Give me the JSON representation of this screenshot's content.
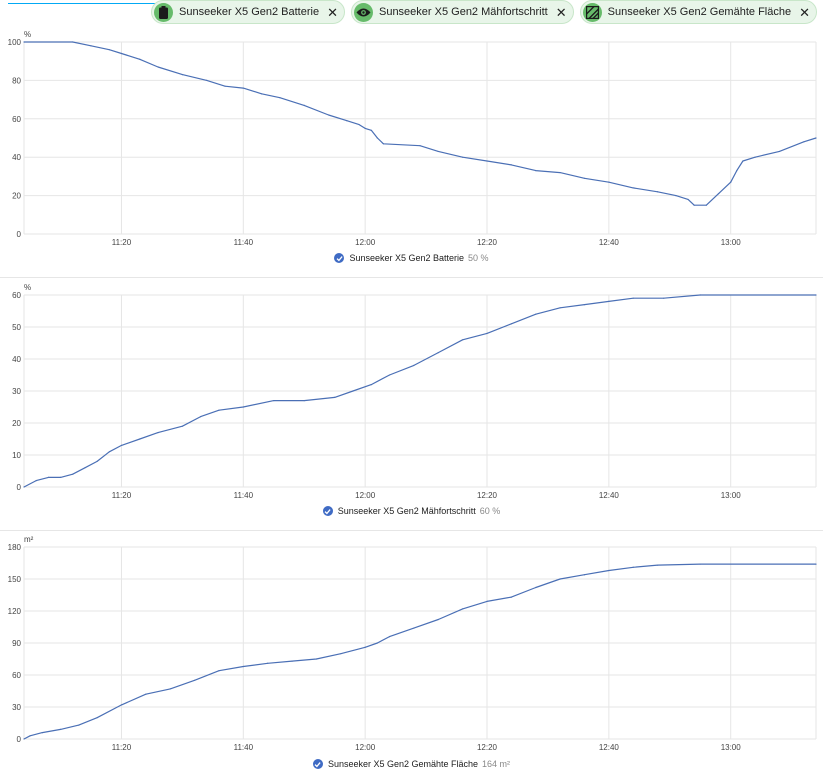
{
  "header": {
    "chips": [
      {
        "label": "Sunseeker X5 Gen2 Batterie",
        "icon": "battery-icon"
      },
      {
        "label": "Sunseeker X5 Gen2 Mähfortschritt",
        "icon": "eye-icon"
      },
      {
        "label": "Sunseeker X5 Gen2 Gemähte Fläche",
        "icon": "texture-icon"
      }
    ],
    "remove_glyph": "✕"
  },
  "colors": {
    "line": "#4a6fb5",
    "grid": "#e6e6e6",
    "accent": "#03a9f4",
    "chip_bg": "#e8f5e9",
    "chip_icon": "#66bb6a"
  },
  "legends": [
    {
      "label": "Sunseeker X5 Gen2 Batterie",
      "value": "50 %"
    },
    {
      "label": "Sunseeker X5 Gen2 Mähfortschritt",
      "value": "60 %"
    },
    {
      "label": "Sunseeker X5 Gen2 Gemähte Fläche",
      "value": "164 m²"
    }
  ],
  "chart_data": [
    {
      "type": "line",
      "unit": "%",
      "ylim": [
        0,
        100
      ],
      "yticks": [
        0,
        20,
        40,
        60,
        80,
        100
      ],
      "xlim": [
        "11:04",
        "13:14"
      ],
      "xticks": [
        "11:20",
        "11:40",
        "12:00",
        "12:20",
        "12:40",
        "13:00"
      ],
      "grid": true,
      "series": [
        {
          "name": "Sunseeker X5 Gen2 Batterie",
          "points": [
            [
              "11:04",
              100
            ],
            [
              "11:12",
              100
            ],
            [
              "11:15",
              98
            ],
            [
              "11:18",
              96
            ],
            [
              "11:20",
              94
            ],
            [
              "11:23",
              91
            ],
            [
              "11:26",
              87
            ],
            [
              "11:30",
              83
            ],
            [
              "11:34",
              80
            ],
            [
              "11:37",
              77
            ],
            [
              "11:40",
              76
            ],
            [
              "11:43",
              73
            ],
            [
              "11:46",
              71
            ],
            [
              "11:50",
              67
            ],
            [
              "11:54",
              62
            ],
            [
              "11:57",
              59
            ],
            [
              "11:59",
              57
            ],
            [
              "12:00",
              55
            ],
            [
              "12:01",
              54
            ],
            [
              "12:02",
              50
            ],
            [
              "12:03",
              47
            ],
            [
              "12:09",
              46
            ],
            [
              "12:12",
              43
            ],
            [
              "12:16",
              40
            ],
            [
              "12:20",
              38
            ],
            [
              "12:24",
              36
            ],
            [
              "12:28",
              33
            ],
            [
              "12:32",
              32
            ],
            [
              "12:36",
              29
            ],
            [
              "12:40",
              27
            ],
            [
              "12:44",
              24
            ],
            [
              "12:48",
              22
            ],
            [
              "12:51",
              20
            ],
            [
              "12:53",
              18
            ],
            [
              "12:54",
              15
            ],
            [
              "12:56",
              15
            ],
            [
              "12:58",
              21
            ],
            [
              "13:00",
              27
            ],
            [
              "13:01",
              33
            ],
            [
              "13:02",
              38
            ],
            [
              "13:04",
              40
            ],
            [
              "13:08",
              43
            ],
            [
              "13:12",
              48
            ],
            [
              "13:14",
              50
            ]
          ]
        }
      ]
    },
    {
      "type": "line",
      "unit": "%",
      "ylim": [
        0,
        60
      ],
      "yticks": [
        0,
        10,
        20,
        30,
        40,
        50,
        60
      ],
      "xlim": [
        "11:04",
        "13:14"
      ],
      "xticks": [
        "11:20",
        "11:40",
        "12:00",
        "12:20",
        "12:40",
        "13:00"
      ],
      "grid": true,
      "series": [
        {
          "name": "Sunseeker X5 Gen2 Mähfortschritt",
          "points": [
            [
              "11:04",
              0
            ],
            [
              "11:06",
              2
            ],
            [
              "11:08",
              3
            ],
            [
              "11:10",
              3
            ],
            [
              "11:12",
              4
            ],
            [
              "11:14",
              6
            ],
            [
              "11:16",
              8
            ],
            [
              "11:18",
              11
            ],
            [
              "11:20",
              13
            ],
            [
              "11:23",
              15
            ],
            [
              "11:26",
              17
            ],
            [
              "11:30",
              19
            ],
            [
              "11:33",
              22
            ],
            [
              "11:36",
              24
            ],
            [
              "11:40",
              25
            ],
            [
              "11:45",
              27
            ],
            [
              "11:50",
              27
            ],
            [
              "11:55",
              28
            ],
            [
              "11:58",
              30
            ],
            [
              "12:01",
              32
            ],
            [
              "12:04",
              35
            ],
            [
              "12:08",
              38
            ],
            [
              "12:12",
              42
            ],
            [
              "12:16",
              46
            ],
            [
              "12:20",
              48
            ],
            [
              "12:24",
              51
            ],
            [
              "12:28",
              54
            ],
            [
              "12:32",
              56
            ],
            [
              "12:36",
              57
            ],
            [
              "12:40",
              58
            ],
            [
              "12:44",
              59
            ],
            [
              "12:49",
              59
            ],
            [
              "12:55",
              60
            ],
            [
              "13:14",
              60
            ]
          ]
        }
      ]
    },
    {
      "type": "line",
      "unit": "m²",
      "ylim": [
        0,
        180
      ],
      "yticks": [
        0,
        30,
        60,
        90,
        120,
        150,
        180
      ],
      "xlim": [
        "11:04",
        "13:14"
      ],
      "xticks": [
        "11:20",
        "11:40",
        "12:00",
        "12:20",
        "12:40",
        "13:00"
      ],
      "grid": true,
      "series": [
        {
          "name": "Sunseeker X5 Gen2 Gemähte Fläche",
          "points": [
            [
              "11:04",
              0
            ],
            [
              "11:05",
              3
            ],
            [
              "11:07",
              6
            ],
            [
              "11:10",
              9
            ],
            [
              "11:13",
              13
            ],
            [
              "11:16",
              20
            ],
            [
              "11:20",
              32
            ],
            [
              "11:24",
              42
            ],
            [
              "11:28",
              47
            ],
            [
              "11:32",
              55
            ],
            [
              "11:36",
              64
            ],
            [
              "11:40",
              68
            ],
            [
              "11:44",
              71
            ],
            [
              "11:48",
              73
            ],
            [
              "11:52",
              75
            ],
            [
              "11:56",
              80
            ],
            [
              "12:00",
              86
            ],
            [
              "12:02",
              90
            ],
            [
              "12:04",
              96
            ],
            [
              "12:08",
              104
            ],
            [
              "12:12",
              112
            ],
            [
              "12:16",
              122
            ],
            [
              "12:20",
              129
            ],
            [
              "12:24",
              133
            ],
            [
              "12:28",
              142
            ],
            [
              "12:32",
              150
            ],
            [
              "12:36",
              154
            ],
            [
              "12:40",
              158
            ],
            [
              "12:44",
              161
            ],
            [
              "12:48",
              163
            ],
            [
              "12:55",
              164
            ],
            [
              "13:14",
              164
            ]
          ]
        }
      ]
    }
  ]
}
